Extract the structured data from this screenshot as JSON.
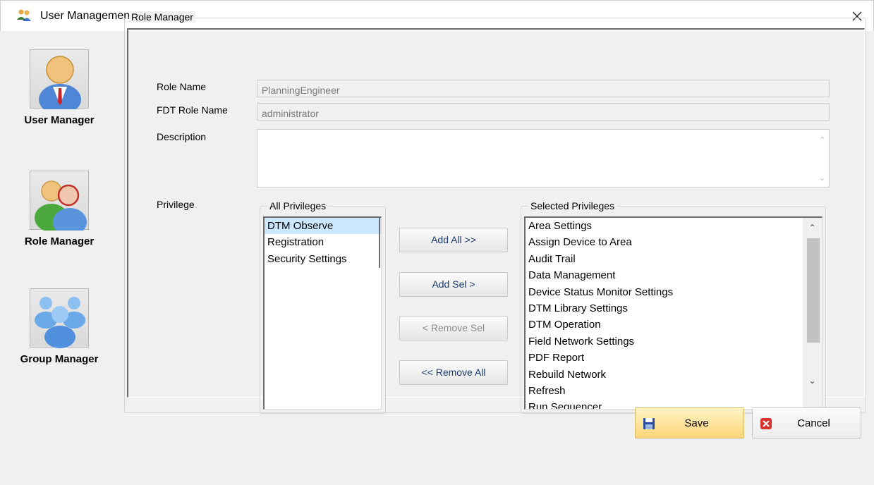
{
  "window": {
    "title": "User Management",
    "icon": "users-icon",
    "close_icon": "close-icon"
  },
  "sidebar": {
    "items": [
      {
        "label": "User Manager",
        "icon": "user-manager-icon"
      },
      {
        "label": "Role Manager",
        "icon": "role-manager-icon"
      },
      {
        "label": "Group Manager",
        "icon": "group-manager-icon"
      }
    ]
  },
  "role_manager": {
    "group_title": "Role Manager",
    "role_name_label": "Role Name",
    "role_name_value": "PlanningEngineer",
    "fdt_role_label": "FDT Role Name",
    "fdt_role_value": "administrator",
    "description_label": "Description",
    "description_value": "",
    "privilege_label": "Privilege",
    "all_privileges": {
      "title": "All Privileges",
      "items": [
        "DTM Observe",
        "Registration",
        "Security Settings"
      ],
      "selected_item": "DTM Observe"
    },
    "selected_privileges": {
      "title": "Selected Privileges",
      "items": [
        "Area Settings",
        "Assign Device to Area",
        "Audit Trail",
        "Data Management",
        "Device Status Monitor Settings",
        "DTM Library Settings",
        "DTM Operation",
        "Field Network Settings",
        "PDF Report",
        "Rebuild Network",
        "Refresh",
        "Run Sequencer"
      ]
    },
    "buttons": {
      "add_all": "Add All >>",
      "add_sel": "Add Sel >",
      "remove_sel": "< Remove Sel",
      "remove_all": "<< Remove All"
    }
  },
  "footer": {
    "save_label": "Save",
    "cancel_label": "Cancel"
  },
  "colors": {
    "selection": "#cce8ff",
    "save_button": "#ffd67a",
    "button_text": "#1a3a6e"
  }
}
